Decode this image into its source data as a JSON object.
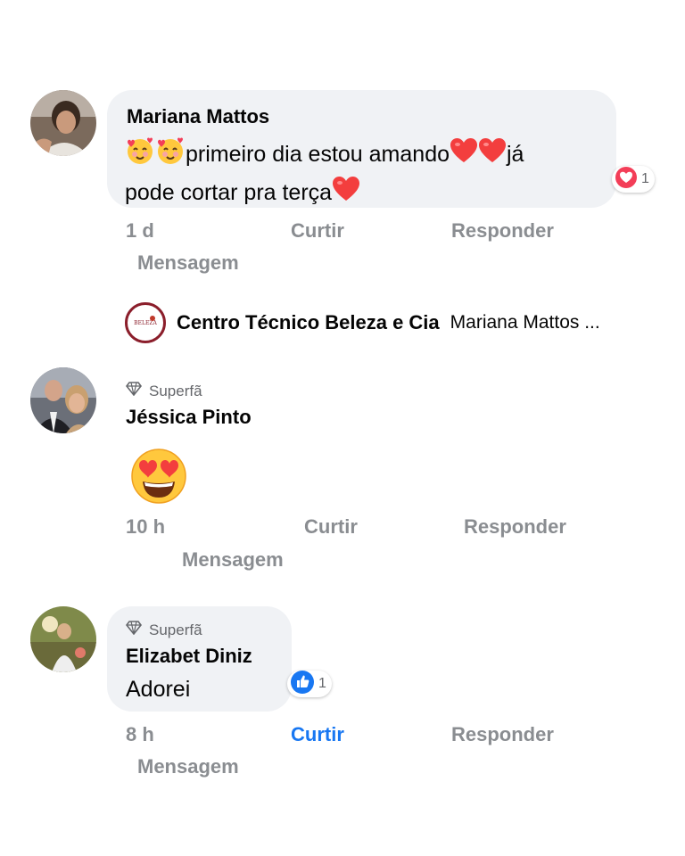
{
  "comments": [
    {
      "author": "Mariana Mattos",
      "text_part1": "primeiro dia estou amando",
      "text_part2": "já",
      "text_part3": "pode cortar pra terça",
      "reaction_count": "1",
      "time": "1 d",
      "like_label": "Curtir",
      "reply_label": "Responder",
      "message_label": "Mensagem"
    },
    {
      "badge": "Superfã",
      "author": "Jéssica Pinto",
      "time": "10 h",
      "like_label": "Curtir",
      "reply_label": "Responder",
      "message_label": "Mensagem"
    },
    {
      "badge": "Superfã",
      "author": "Elizabet Diniz",
      "text": "Adorei",
      "reaction_count": "1",
      "time": "8 h",
      "like_label": "Curtir",
      "reply_label": "Responder",
      "message_label": "Mensagem"
    }
  ],
  "reply_preview": {
    "page_name": "Centro Técnico Beleza e Cia",
    "snippet": "Mariana Mattos ..."
  },
  "colors": {
    "bubble_bg": "#f0f2f5",
    "meta_gray": "#8a8d91",
    "link_blue": "#1877f2",
    "heart_red": "#f33e58",
    "logo_border": "#8b1e2b"
  }
}
